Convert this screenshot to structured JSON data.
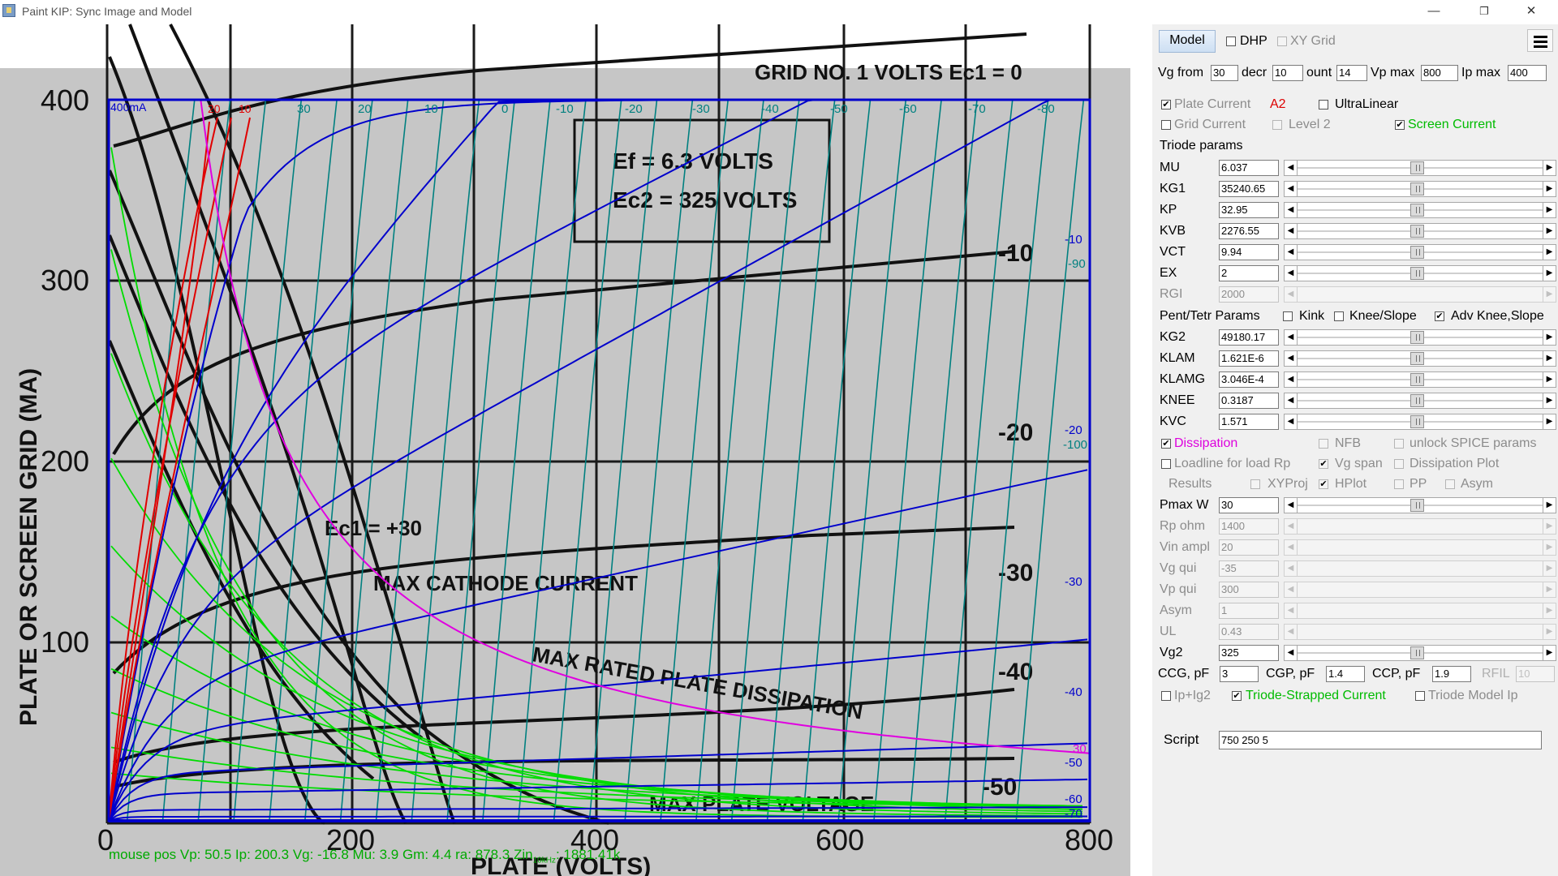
{
  "window": {
    "title": "Paint KIP: Sync Image and Model",
    "minimize": "—",
    "restore": "❐",
    "close": "✕"
  },
  "plot": {
    "x_ticks": [
      "0",
      "200",
      "400",
      "600",
      "800"
    ],
    "y_ticks": [
      "400",
      "300",
      "200",
      "100"
    ],
    "scanned_ylabel": "PLATE OR SCREEN GRID (MA)",
    "scanned_xlabel": "PLATE (VOLTS)",
    "scanned_box_line1": "Ef = 6.3 VOLTS",
    "scanned_box_line2": "Ec2 = 325 VOLTS",
    "scanned_header": "GRID NO. 1 VOLTS Ec1 = 0",
    "scanned_max_cathode": "MAX CATHODE CURRENT",
    "scanned_max_dissipation": "MAX RATED PLATE DISSIPATION",
    "scanned_max_voltage": "MAX PLATE VOLTAGE",
    "scanned_ec1": "Ec1 = +30",
    "scanned_right_labels": [
      "-10",
      "-20",
      "-30",
      "-40",
      "-50"
    ],
    "overlay_corner": "400mA",
    "overlay_red_labels": [
      "20",
      "10"
    ],
    "overlay_teal_top": [
      "30",
      "20",
      "10",
      "0",
      "-10",
      "-20",
      "-30",
      "-40",
      "-50",
      "-60",
      "-70",
      "-80"
    ],
    "overlay_teal_top_pos": [
      "30",
      "20",
      "10",
      "0"
    ],
    "overlay_teal_top_neg": [
      "-10",
      "-20",
      "-30",
      "-40",
      "-50",
      "-60",
      "-70",
      "-80"
    ],
    "overlay_blue_right": [
      "-10",
      "-20",
      "-30",
      "-40",
      "-50",
      "-60",
      "-70"
    ],
    "overlay_teal_right": [
      "-90",
      "-100"
    ],
    "overlay_magenta_right": "30",
    "mouse_status": "mouse pos Vp: 50.5    Ip: 200.3    Vg: -16.8    Mu: 3.9    Gm: 4.4    ra: 878.3    Zin",
    "mouse_status_sub": "10kHz",
    "mouse_status_tail": ": 1881.41k"
  },
  "panel": {
    "model_button": "Model",
    "dhp_label": "DHP",
    "xygrid_label": "XY Grid",
    "vg_from_label": "Vg from",
    "vg_from": "30",
    "decr_label": "decr",
    "decr": "10",
    "count_label": "ount",
    "count": "14",
    "vpmax_label": "Vp max",
    "vpmax": "800",
    "ipmax_label": "Ip max",
    "ipmax": "400",
    "plate_current_label": "Plate Current",
    "a2_label": "A2",
    "ultralinear_label": "UltraLinear",
    "grid_current_label": "Grid Current",
    "level2_label": "Level 2",
    "screen_current_label": "Screen Current",
    "triode_params_label": "Triode params",
    "triode_params": [
      {
        "name": "MU",
        "value": "6.037"
      },
      {
        "name": "KG1",
        "value": "35240.65"
      },
      {
        "name": "KP",
        "value": "32.95"
      },
      {
        "name": "KVB",
        "value": "2276.55"
      },
      {
        "name": "VCT",
        "value": "9.94"
      },
      {
        "name": "EX",
        "value": "2"
      },
      {
        "name": "RGI",
        "value": "2000"
      }
    ],
    "pent_params_label": "Pent/Tetr Params",
    "kink_label": "Kink",
    "knee_slope_label": "Knee/Slope",
    "adv_knee_label": "Adv Knee,Slope",
    "pent_params": [
      {
        "name": "KG2",
        "value": "49180.17"
      },
      {
        "name": "KLAM",
        "value": "1.621E-6"
      },
      {
        "name": "KLAMG",
        "value": "3.046E-4"
      },
      {
        "name": "KNEE",
        "value": "0.3187"
      },
      {
        "name": "KVC",
        "value": "1.571"
      }
    ],
    "dissipation_label": "Dissipation",
    "nfb_label": "NFB",
    "unlock_spice_label": "unlock SPICE params",
    "loadline_label": "Loadline for load Rp",
    "vg_span_label": "Vg span",
    "dissipation_plot_label": "Dissipation Plot",
    "results_label": "Results",
    "xyproj_label": "XYProj",
    "hplot_label": "HPlot",
    "pp_label": "PP",
    "asym_check_label": "Asym",
    "load_params": [
      {
        "name": "Pmax W",
        "value": "30"
      },
      {
        "name": "Rp ohm",
        "value": "1400"
      },
      {
        "name": "Vin ampl",
        "value": "20"
      },
      {
        "name": "Vg qui",
        "value": "-35"
      },
      {
        "name": "Vp qui",
        "value": "300"
      },
      {
        "name": "Asym",
        "value": "1"
      },
      {
        "name": "UL",
        "value": "0.43"
      },
      {
        "name": "Vg2",
        "value": "325"
      }
    ],
    "ccg_label": "CCG, pF",
    "ccg": "3",
    "cgp_label": "CGP, pF",
    "cgp": "1.4",
    "ccp_label": "CCP, pF",
    "ccp": "1.9",
    "rfil_label": "RFIL",
    "rfil": "10",
    "ip_ig2_label": "Ip+Ig2",
    "triode_strapped_label": "Triode-Strapped Current",
    "triode_model_ip_label": "Triode Model Ip",
    "script_label": "Script",
    "script_value": "750 250 5",
    "check_mark": "✔",
    "arrow_left": "◀",
    "arrow_right": "▶"
  },
  "colors": {
    "plot_frame": "#0000cc",
    "green": "#00d000",
    "red": "#e00000",
    "teal": "#007a7a",
    "magenta": "#e000e0",
    "accent_green": "#00bb00",
    "accent_red": "#dd0000",
    "accent_magenta": "#dd00dd"
  }
}
